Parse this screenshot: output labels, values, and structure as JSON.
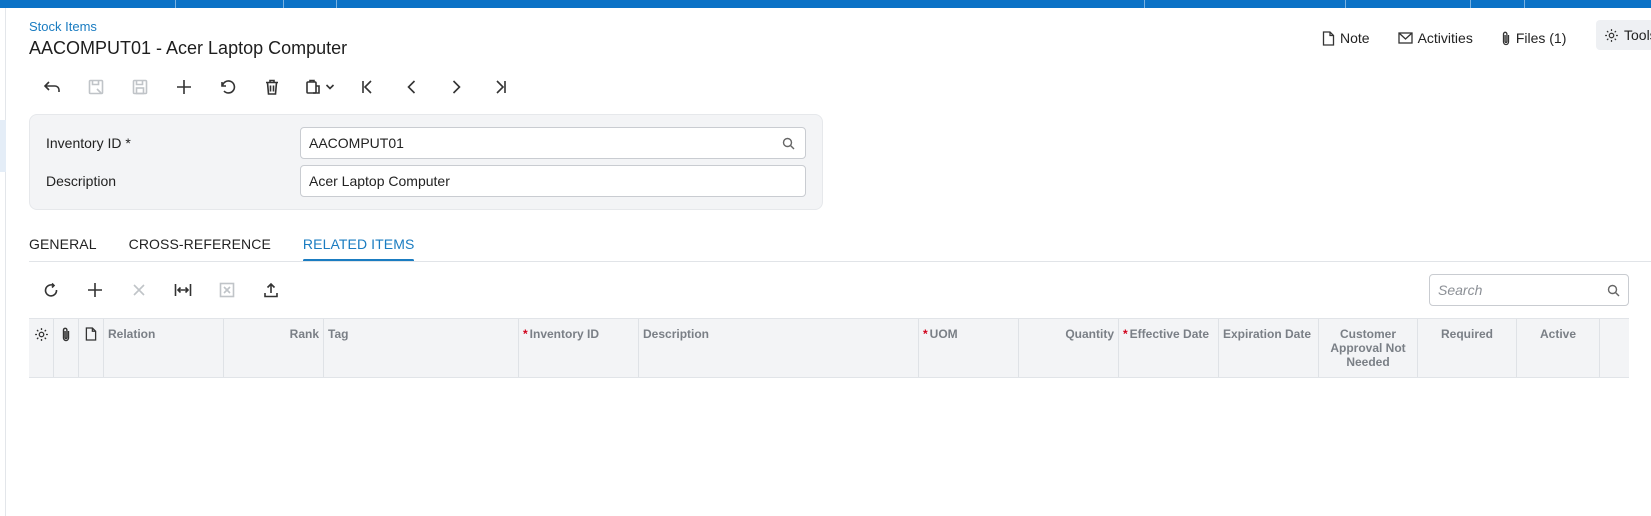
{
  "breadcrumb": "Stock Items",
  "title": "AACOMPUT01 - Acer Laptop Computer",
  "header_actions": {
    "note": "Note",
    "activities": "Activities",
    "files": "Files (1)",
    "tools": "Tools"
  },
  "toolbar_icons": [
    "back-icon",
    "save-close-icon",
    "save-icon",
    "add-icon",
    "undo-icon",
    "delete-icon",
    "copy-paste-icon",
    "first-record-icon",
    "previous-record-icon",
    "next-record-icon",
    "last-record-icon"
  ],
  "form": {
    "inventory_id_label": "Inventory ID *",
    "inventory_id_value": "AACOMPUT01",
    "description_label": "Description",
    "description_value": "Acer Laptop Computer"
  },
  "tabs": [
    {
      "label": "GENERAL",
      "active": false
    },
    {
      "label": "CROSS-REFERENCE",
      "active": false
    },
    {
      "label": "RELATED ITEMS",
      "active": true
    }
  ],
  "grid_toolbar_icons": [
    "refresh-icon",
    "add-row-icon",
    "delete-row-icon",
    "fit-columns-icon",
    "export-excel-icon",
    "upload-icon"
  ],
  "search": {
    "placeholder": "Search"
  },
  "grid_columns": {
    "relation": "Relation",
    "rank": "Rank",
    "tag": "Tag",
    "inventory_id": "Inventory ID",
    "description": "Description",
    "uom": "UOM",
    "quantity": "Quantity",
    "effective_date": "Effective Date",
    "expiration_date": "Expiration Date",
    "customer_approval": "Customer Approval Not Needed",
    "required": "Required",
    "active": "Active"
  },
  "required_marker": "*",
  "colors": {
    "accent": "#1a7cc1",
    "topbar": "#0b72c6",
    "required": "#d0021b"
  }
}
